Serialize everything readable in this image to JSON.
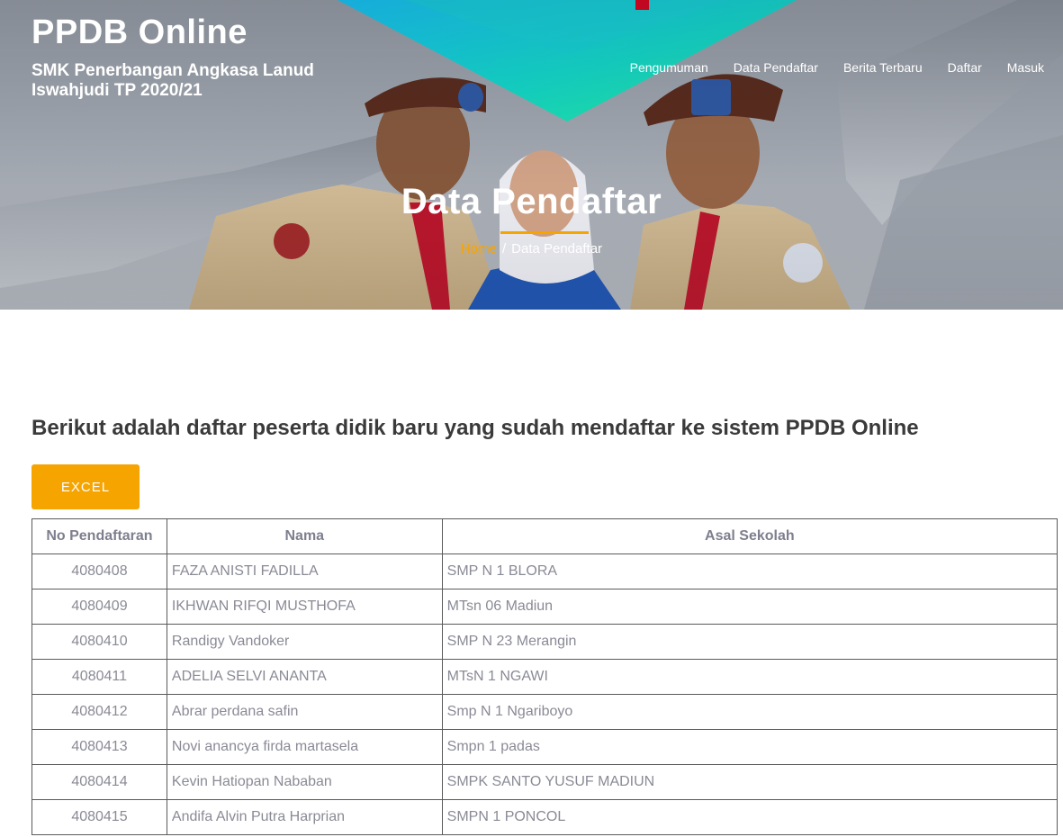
{
  "brand": {
    "title": "PPDB Online",
    "subtitle": "SMK Penerbangan Angkasa Lanud Iswahjudi TP 2020/21"
  },
  "nav": {
    "items": [
      {
        "label": "Pengumuman"
      },
      {
        "label": "Data Pendaftar"
      },
      {
        "label": "Berita Terbaru"
      },
      {
        "label": "Daftar"
      },
      {
        "label": "Masuk"
      }
    ]
  },
  "hero": {
    "title": "Data Pendaftar",
    "breadcrumb": {
      "home": "Home",
      "separator": "/",
      "current": "Data Pendaftar"
    }
  },
  "content": {
    "intro": "Berikut adalah daftar peserta didik baru yang sudah mendaftar ke sistem PPDB Online",
    "excel_label": "EXCEL"
  },
  "table": {
    "headers": [
      "No Pendaftaran",
      "Nama",
      "Asal Sekolah"
    ],
    "rows": [
      [
        "4080408",
        "FAZA ANISTI FADILLA",
        "SMP N 1 BLORA"
      ],
      [
        "4080409",
        "IKHWAN RIFQI MUSTHOFA",
        "MTsn 06 Madiun"
      ],
      [
        "4080410",
        "Randigy Vandoker",
        "SMP N 23 Merangin"
      ],
      [
        "4080411",
        "ADELIA SELVI ANANTA",
        "MTsN 1 NGAWI"
      ],
      [
        "4080412",
        "Abrar perdana safin",
        "Smp N 1 Ngariboyo"
      ],
      [
        "4080413",
        "Novi anancya firda martasela",
        "Smpn 1 padas"
      ],
      [
        "4080414",
        "Kevin Hatiopan Nababan",
        "SMPK SANTO YUSUF MADIUN"
      ],
      [
        "4080415",
        "Andifa Alvin Putra Harprian",
        "SMPN 1 PONCOL"
      ]
    ]
  },
  "colors": {
    "accent": "#f6a400",
    "text_dark": "#3a3a3a",
    "table_text": "#8a8a96"
  }
}
